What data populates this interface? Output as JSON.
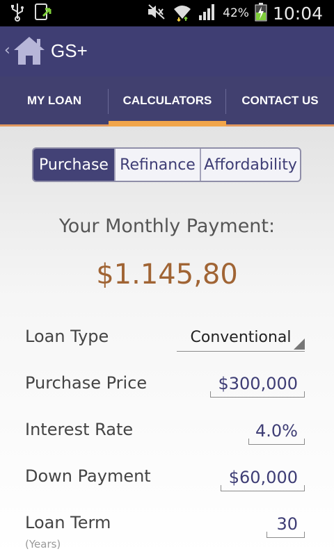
{
  "status_bar": {
    "battery_percent": "42%",
    "time": "10:04",
    "icons": [
      "usb-icon",
      "update-icon",
      "mute-icon",
      "wifi-icon",
      "signal-icon",
      "battery-charging-icon"
    ]
  },
  "app_bar": {
    "title": "GS+",
    "icons": [
      "back-chevron-icon",
      "home-icon"
    ]
  },
  "tabs": [
    {
      "label": "MY LOAN",
      "active": false
    },
    {
      "label": "CALCULATORS",
      "active": true
    },
    {
      "label": "CONTACT US",
      "active": false
    }
  ],
  "calculator_modes": [
    {
      "label": "Purchase",
      "active": true
    },
    {
      "label": "Refinance",
      "active": false
    },
    {
      "label": "Affordability",
      "active": false
    }
  ],
  "monthly_payment": {
    "label": "Your Monthly Payment:",
    "value": "$1.145,80"
  },
  "form": {
    "loan_type": {
      "label": "Loan Type",
      "value": "Conventional"
    },
    "purchase_price": {
      "label": "Purchase Price",
      "value": "$300,000"
    },
    "interest_rate": {
      "label": "Interest Rate",
      "value": "4.0%"
    },
    "down_payment": {
      "label": "Down Payment",
      "value": "$60,000"
    },
    "loan_term": {
      "label": "Loan Term",
      "sub": "(Years)",
      "value": "30"
    }
  },
  "colors": {
    "app_bar": "#3f3e73",
    "accent_orange": "#f1a54a",
    "payment_value": "#a06434",
    "segment_active": "#434276"
  }
}
